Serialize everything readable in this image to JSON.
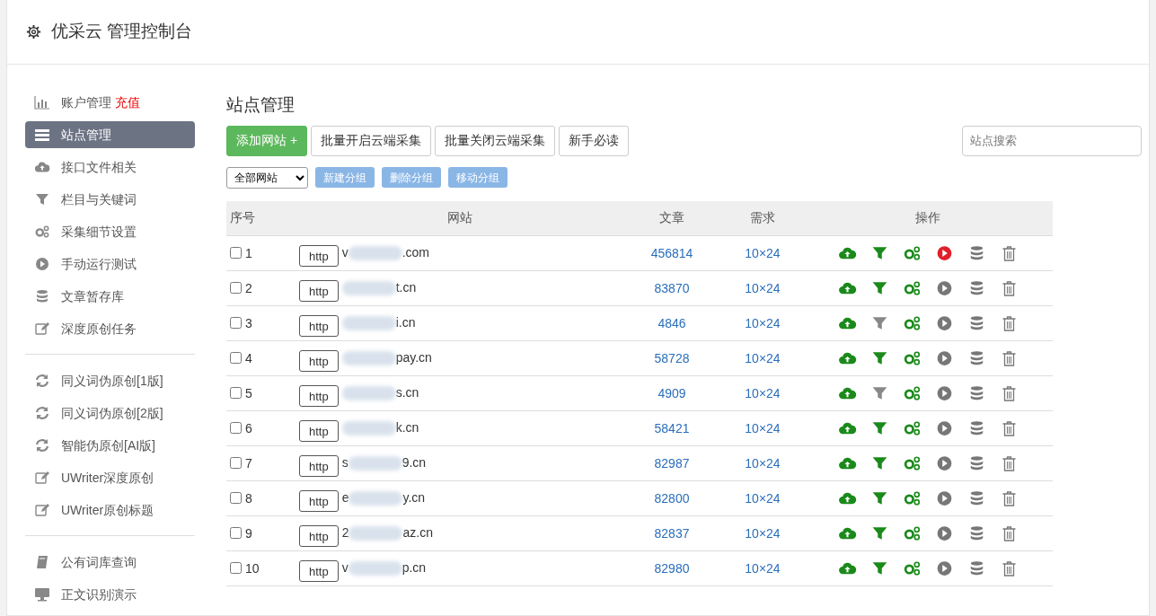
{
  "header": {
    "title": "优采云 管理控制台"
  },
  "sidebar": {
    "groups": [
      {
        "items": [
          {
            "label": "账户管理",
            "extra": "充值",
            "selected": false
          },
          {
            "label": "站点管理",
            "selected": true
          },
          {
            "label": "接口文件相关",
            "selected": false
          },
          {
            "label": "栏目与关键词",
            "selected": false
          },
          {
            "label": "采集细节设置",
            "selected": false
          },
          {
            "label": "手动运行测试",
            "selected": false
          },
          {
            "label": "文章暂存库",
            "selected": false
          },
          {
            "label": "深度原创任务",
            "selected": false
          }
        ]
      },
      {
        "items": [
          {
            "label": "同义词伪原创[1版]",
            "selected": false
          },
          {
            "label": "同义词伪原创[2版]",
            "selected": false
          },
          {
            "label": "智能伪原创[AI版]",
            "selected": false
          },
          {
            "label": "UWriter深度原创",
            "selected": false
          },
          {
            "label": "UWriter原创标题",
            "selected": false
          }
        ]
      },
      {
        "items": [
          {
            "label": "公有词库查询",
            "selected": false
          },
          {
            "label": "正文识别演示",
            "selected": false
          }
        ]
      }
    ]
  },
  "main": {
    "title": "站点管理",
    "buttons": [
      {
        "label": "添加网站 +",
        "kind": "primary"
      },
      {
        "label": "批量开启云端采集",
        "kind": "default"
      },
      {
        "label": "批量关闭云端采集",
        "kind": "default"
      },
      {
        "label": "新手必读",
        "kind": "default"
      }
    ],
    "search": {
      "placeholder": "站点搜索"
    },
    "group_select": {
      "value": "全部网站"
    },
    "group_buttons": [
      "新建分组",
      "删除分组",
      "移动分组"
    ],
    "table": {
      "columns": [
        "序号",
        "网站",
        "文章",
        "需求",
        "操作"
      ],
      "rows": [
        {
          "checked": false,
          "index": "1",
          "scheme": "http",
          "domain_start": "v",
          "domain_end": ".com",
          "articles": "456814",
          "demand": "10×24",
          "filter_on": true,
          "running": true
        },
        {
          "checked": false,
          "index": "2",
          "scheme": "http",
          "domain_end": "t.cn",
          "articles": "83870",
          "demand": "10×24",
          "filter_on": true,
          "running": false
        },
        {
          "checked": false,
          "index": "3",
          "scheme": "http",
          "domain_end": "i.cn",
          "articles": "4846",
          "demand": "10×24",
          "filter_on": false,
          "running": false
        },
        {
          "checked": false,
          "index": "4",
          "scheme": "http",
          "domain_end": "pay.cn",
          "articles": "58728",
          "demand": "10×24",
          "filter_on": true,
          "running": false
        },
        {
          "checked": false,
          "index": "5",
          "scheme": "http",
          "domain_end": "s.cn",
          "articles": "4909",
          "demand": "10×24",
          "filter_on": false,
          "running": false
        },
        {
          "checked": false,
          "index": "6",
          "scheme": "http",
          "domain_end": "k.cn",
          "articles": "58421",
          "demand": "10×24",
          "filter_on": true,
          "running": false
        },
        {
          "checked": false,
          "index": "7",
          "scheme": "http",
          "domain_start": "s",
          "domain_end": "9.cn",
          "articles": "82987",
          "demand": "10×24",
          "filter_on": true,
          "running": false
        },
        {
          "checked": false,
          "index": "8",
          "scheme": "http",
          "domain_start": "e",
          "domain_end": "y.cn",
          "articles": "82800",
          "demand": "10×24",
          "filter_on": true,
          "running": false
        },
        {
          "checked": false,
          "index": "9",
          "scheme": "http",
          "domain_start": "2",
          "domain_end": "az.cn",
          "articles": "82837",
          "demand": "10×24",
          "filter_on": true,
          "running": false
        },
        {
          "checked": false,
          "index": "10",
          "scheme": "http",
          "domain_start": "v",
          "domain_end": "p.cn",
          "articles": "82980",
          "demand": "10×24",
          "filter_on": true,
          "running": false
        }
      ]
    }
  }
}
